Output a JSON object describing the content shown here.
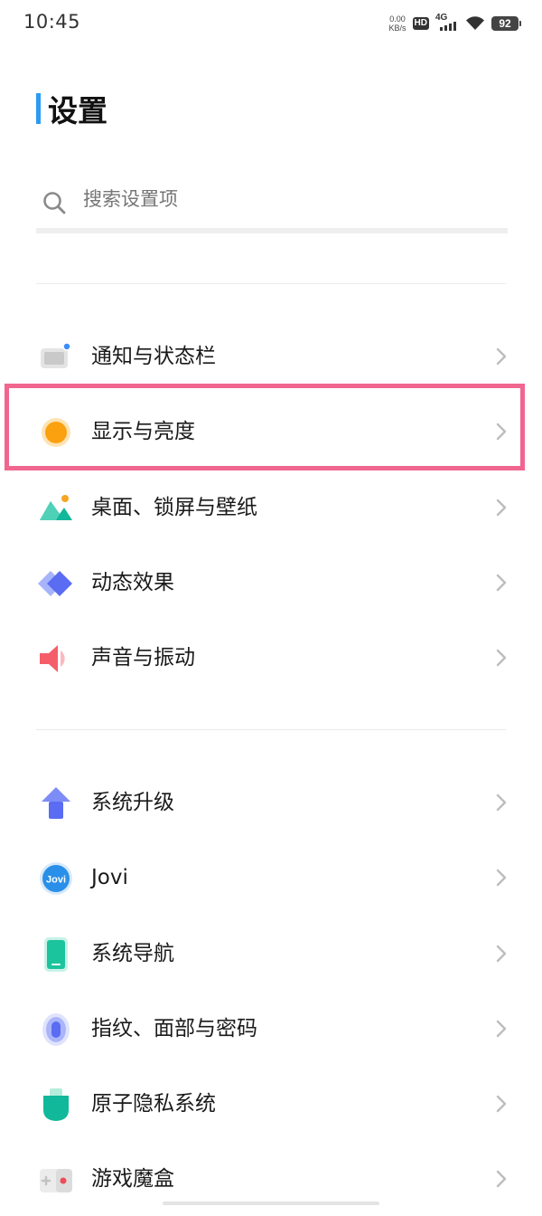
{
  "status_bar": {
    "time": "10:45",
    "net_speed_value": "0.00",
    "net_speed_unit": "KB/s",
    "hd": "HD",
    "network": "4G",
    "battery": "92"
  },
  "title": "设置",
  "search": {
    "placeholder": "搜索设置项"
  },
  "groups": [
    {
      "items": [
        {
          "label": "通知与状态栏",
          "icon": "notification-icon"
        },
        {
          "label": "显示与亮度",
          "icon": "display-brightness-icon",
          "highlighted": true
        },
        {
          "label": "桌面、锁屏与壁纸",
          "icon": "wallpaper-icon"
        },
        {
          "label": "动态效果",
          "icon": "animation-icon"
        },
        {
          "label": "声音与振动",
          "icon": "sound-icon"
        }
      ]
    },
    {
      "items": [
        {
          "label": "系统升级",
          "icon": "system-update-icon"
        },
        {
          "label": "Jovi",
          "icon": "jovi-icon"
        },
        {
          "label": "系统导航",
          "icon": "navigation-icon"
        },
        {
          "label": "指纹、面部与密码",
          "icon": "fingerprint-icon"
        },
        {
          "label": "原子隐私系统",
          "icon": "privacy-icon"
        },
        {
          "label": "游戏魔盒",
          "icon": "game-box-icon"
        }
      ]
    }
  ],
  "colors": {
    "accent": "#2b9bf4",
    "highlight_border": "#f0668f"
  }
}
